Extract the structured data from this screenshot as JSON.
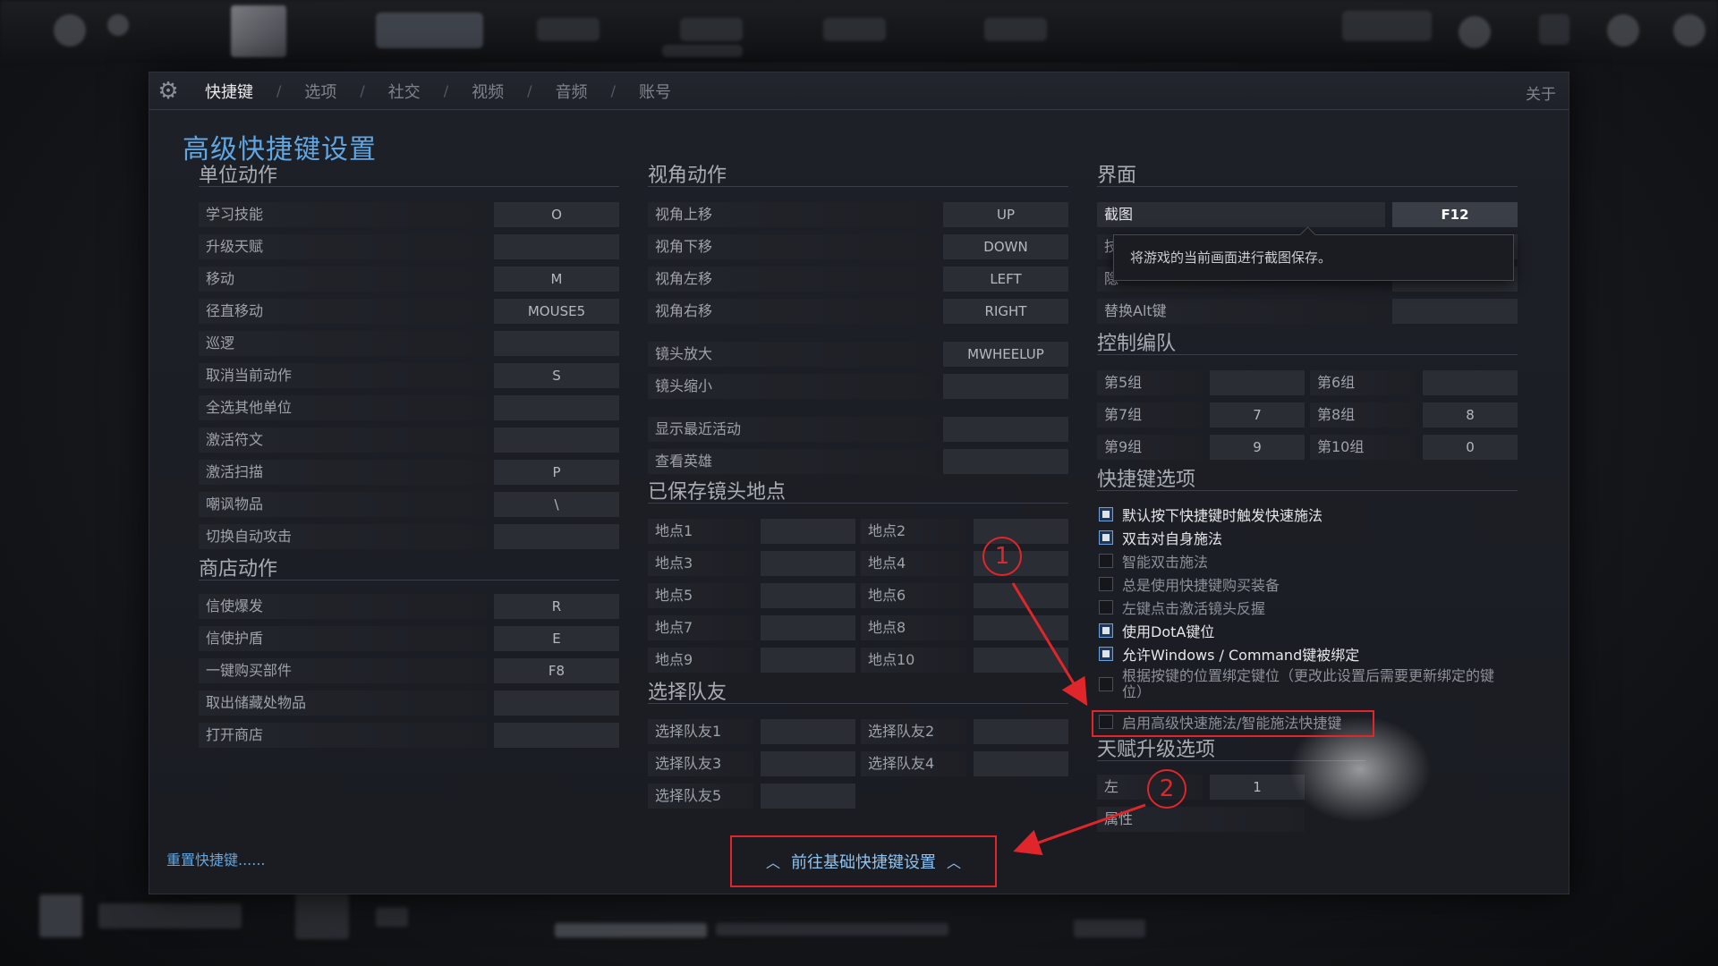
{
  "tabs": {
    "active": "快捷键",
    "items": [
      "选项",
      "社交",
      "视频",
      "音频",
      "账号"
    ],
    "separator": "/",
    "about": "关于"
  },
  "page_title": "高级快捷键设置",
  "unit_actions": {
    "title": "单位动作",
    "rows": [
      {
        "label": "学习技能",
        "key": "O"
      },
      {
        "label": "升级天赋",
        "key": ""
      },
      {
        "label": "移动",
        "key": "M"
      },
      {
        "label": "径直移动",
        "key": "MOUSE5"
      },
      {
        "label": "巡逻",
        "key": ""
      },
      {
        "label": "取消当前动作",
        "key": "S"
      },
      {
        "label": "全选其他单位",
        "key": ""
      },
      {
        "label": "激活符文",
        "key": ""
      },
      {
        "label": "激活扫描",
        "key": "P"
      },
      {
        "label": "嘲讽物品",
        "key": "\\"
      },
      {
        "label": "切换自动攻击",
        "key": ""
      }
    ]
  },
  "shop_actions": {
    "title": "商店动作",
    "rows": [
      {
        "label": "信使爆发",
        "key": "R"
      },
      {
        "label": "信使护盾",
        "key": "E"
      },
      {
        "label": "一键购买部件",
        "key": "F8"
      },
      {
        "label": "取出储藏处物品",
        "key": ""
      },
      {
        "label": "打开商店",
        "key": ""
      }
    ]
  },
  "camera_actions": {
    "title": "视角动作",
    "rows": [
      {
        "label": "视角上移",
        "key": "UP"
      },
      {
        "label": "视角下移",
        "key": "DOWN"
      },
      {
        "label": "视角左移",
        "key": "LEFT"
      },
      {
        "label": "视角右移",
        "key": "RIGHT"
      },
      {
        "label": "镜头放大",
        "key": "MWHEELUP"
      },
      {
        "label": "镜头缩小",
        "key": ""
      },
      {
        "label": "显示最近活动",
        "key": ""
      },
      {
        "label": "查看英雄",
        "key": ""
      }
    ]
  },
  "saved_camera": {
    "title": "已保存镜头地点",
    "rows": [
      [
        "地点1",
        "",
        "地点2",
        ""
      ],
      [
        "地点3",
        "",
        "地点4",
        ""
      ],
      [
        "地点5",
        "",
        "地点6",
        ""
      ],
      [
        "地点7",
        "",
        "地点8",
        ""
      ],
      [
        "地点9",
        "",
        "地点10",
        ""
      ]
    ]
  },
  "select_ally": {
    "title": "选择队友",
    "rows": [
      [
        "选择队友1",
        "",
        "选择队友2",
        ""
      ],
      [
        "选择队友3",
        "",
        "选择队友4",
        ""
      ],
      [
        "选择队友5",
        ""
      ]
    ]
  },
  "interface": {
    "title": "界面",
    "screenshot_label": "截图",
    "screenshot_key": "F12",
    "hidden_row_1": "技",
    "hidden_row_2": "隐",
    "alt_label": "替换Alt键",
    "alt_key": "",
    "tooltip": "将游戏的当前画面进行截图保存。"
  },
  "control_groups": {
    "title": "控制编队",
    "rows": [
      [
        "第5组",
        "",
        "第6组",
        ""
      ],
      [
        "第7组",
        "7",
        "第8组",
        "8"
      ],
      [
        "第9组",
        "9",
        "第10组",
        "0"
      ]
    ]
  },
  "hotkey_options": {
    "title": "快捷键选项",
    "items": [
      {
        "label": "默认按下快捷键时触发快速施法",
        "checked": true
      },
      {
        "label": "双击对自身施法",
        "checked": true
      },
      {
        "label": "智能双击施法",
        "checked": false
      },
      {
        "label": "总是使用快捷键购买装备",
        "checked": false
      },
      {
        "label": "左键点击激活镜头反握",
        "checked": false
      },
      {
        "label": "使用DotA键位",
        "checked": true
      },
      {
        "label": "允许Windows / Command键被绑定",
        "checked": true
      },
      {
        "label": "根据按键的位置绑定键位（更改此设置后需要更新绑定的键位）",
        "checked": false
      },
      {
        "label": "启用高级快速施法/智能施法快捷键",
        "checked": false
      }
    ]
  },
  "talent_options": {
    "title": "天赋升级选项",
    "left_label": "左",
    "left_key": "1",
    "attr_label": "属性"
  },
  "reset_link": "重置快捷键......",
  "basic_button": "前往基础快捷键设置",
  "callouts": [
    "1",
    "2"
  ],
  "colors": {
    "accent": "#5fa6e3",
    "highlight": "#e0262a"
  }
}
